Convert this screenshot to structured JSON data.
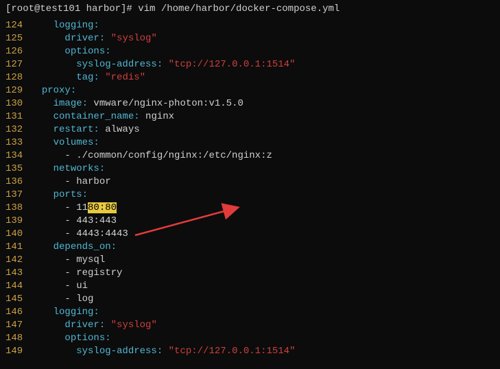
{
  "prompt": "[root@test101 harbor]# vim /home/harbor/docker-compose.yml",
  "lines": [
    {
      "no": "124",
      "indent": "    ",
      "key": "logging",
      "colon": ":",
      "value": ""
    },
    {
      "no": "125",
      "indent": "      ",
      "key": "driver",
      "colon": ":",
      "value": " \"syslog\"",
      "vtype": "string"
    },
    {
      "no": "126",
      "indent": "      ",
      "key": "options",
      "colon": ":",
      "value": ""
    },
    {
      "no": "127",
      "indent": "        ",
      "key": "syslog-address",
      "colon": ":",
      "value": " \"tcp://127.0.0.1:1514\"",
      "vtype": "string"
    },
    {
      "no": "128",
      "indent": "        ",
      "key": "tag",
      "colon": ":",
      "value": " \"redis\"",
      "vtype": "string"
    },
    {
      "no": "129",
      "indent": "  ",
      "key": "proxy",
      "colon": ":",
      "value": ""
    },
    {
      "no": "130",
      "indent": "    ",
      "key": "image",
      "colon": ":",
      "value": " vmware/nginx-photon:v1.5.0",
      "vtype": "plain"
    },
    {
      "no": "131",
      "indent": "    ",
      "key": "container_name",
      "colon": ":",
      "value": " nginx",
      "vtype": "plain"
    },
    {
      "no": "132",
      "indent": "    ",
      "key": "restart",
      "colon": ":",
      "value": " always",
      "vtype": "plain"
    },
    {
      "no": "133",
      "indent": "    ",
      "key": "volumes",
      "colon": ":",
      "value": ""
    },
    {
      "no": "134",
      "indent": "      ",
      "plaintext": "- ./common/config/nginx:/etc/nginx:z"
    },
    {
      "no": "135",
      "indent": "    ",
      "key": "networks",
      "colon": ":",
      "value": ""
    },
    {
      "no": "136",
      "indent": "      ",
      "plaintext": "- harbor"
    },
    {
      "no": "137",
      "indent": "    ",
      "key": "ports",
      "colon": ":",
      "value": ""
    },
    {
      "no": "138",
      "indent": "      ",
      "highlight_line": true,
      "pre": "- 11",
      "hl1": "80",
      "mid": ":",
      "hl2": "80"
    },
    {
      "no": "139",
      "indent": "      ",
      "plaintext": "- 443:443"
    },
    {
      "no": "140",
      "indent": "      ",
      "plaintext": "- 4443:4443"
    },
    {
      "no": "141",
      "indent": "    ",
      "key": "depends_on",
      "colon": ":",
      "value": ""
    },
    {
      "no": "142",
      "indent": "      ",
      "plaintext": "- mysql"
    },
    {
      "no": "143",
      "indent": "      ",
      "plaintext": "- registry"
    },
    {
      "no": "144",
      "indent": "      ",
      "plaintext": "- ui"
    },
    {
      "no": "145",
      "indent": "      ",
      "plaintext": "- log"
    },
    {
      "no": "146",
      "indent": "    ",
      "key": "logging",
      "colon": ":",
      "value": ""
    },
    {
      "no": "147",
      "indent": "      ",
      "key": "driver",
      "colon": ":",
      "value": " \"syslog\"",
      "vtype": "string"
    },
    {
      "no": "148",
      "indent": "      ",
      "key": "options",
      "colon": ":",
      "value": ""
    },
    {
      "no": "149",
      "indent": "        ",
      "key": "syslog-address",
      "colon": ":",
      "value": " \"tcp://127.0.0.1:1514\"",
      "vtype": "string"
    }
  ]
}
